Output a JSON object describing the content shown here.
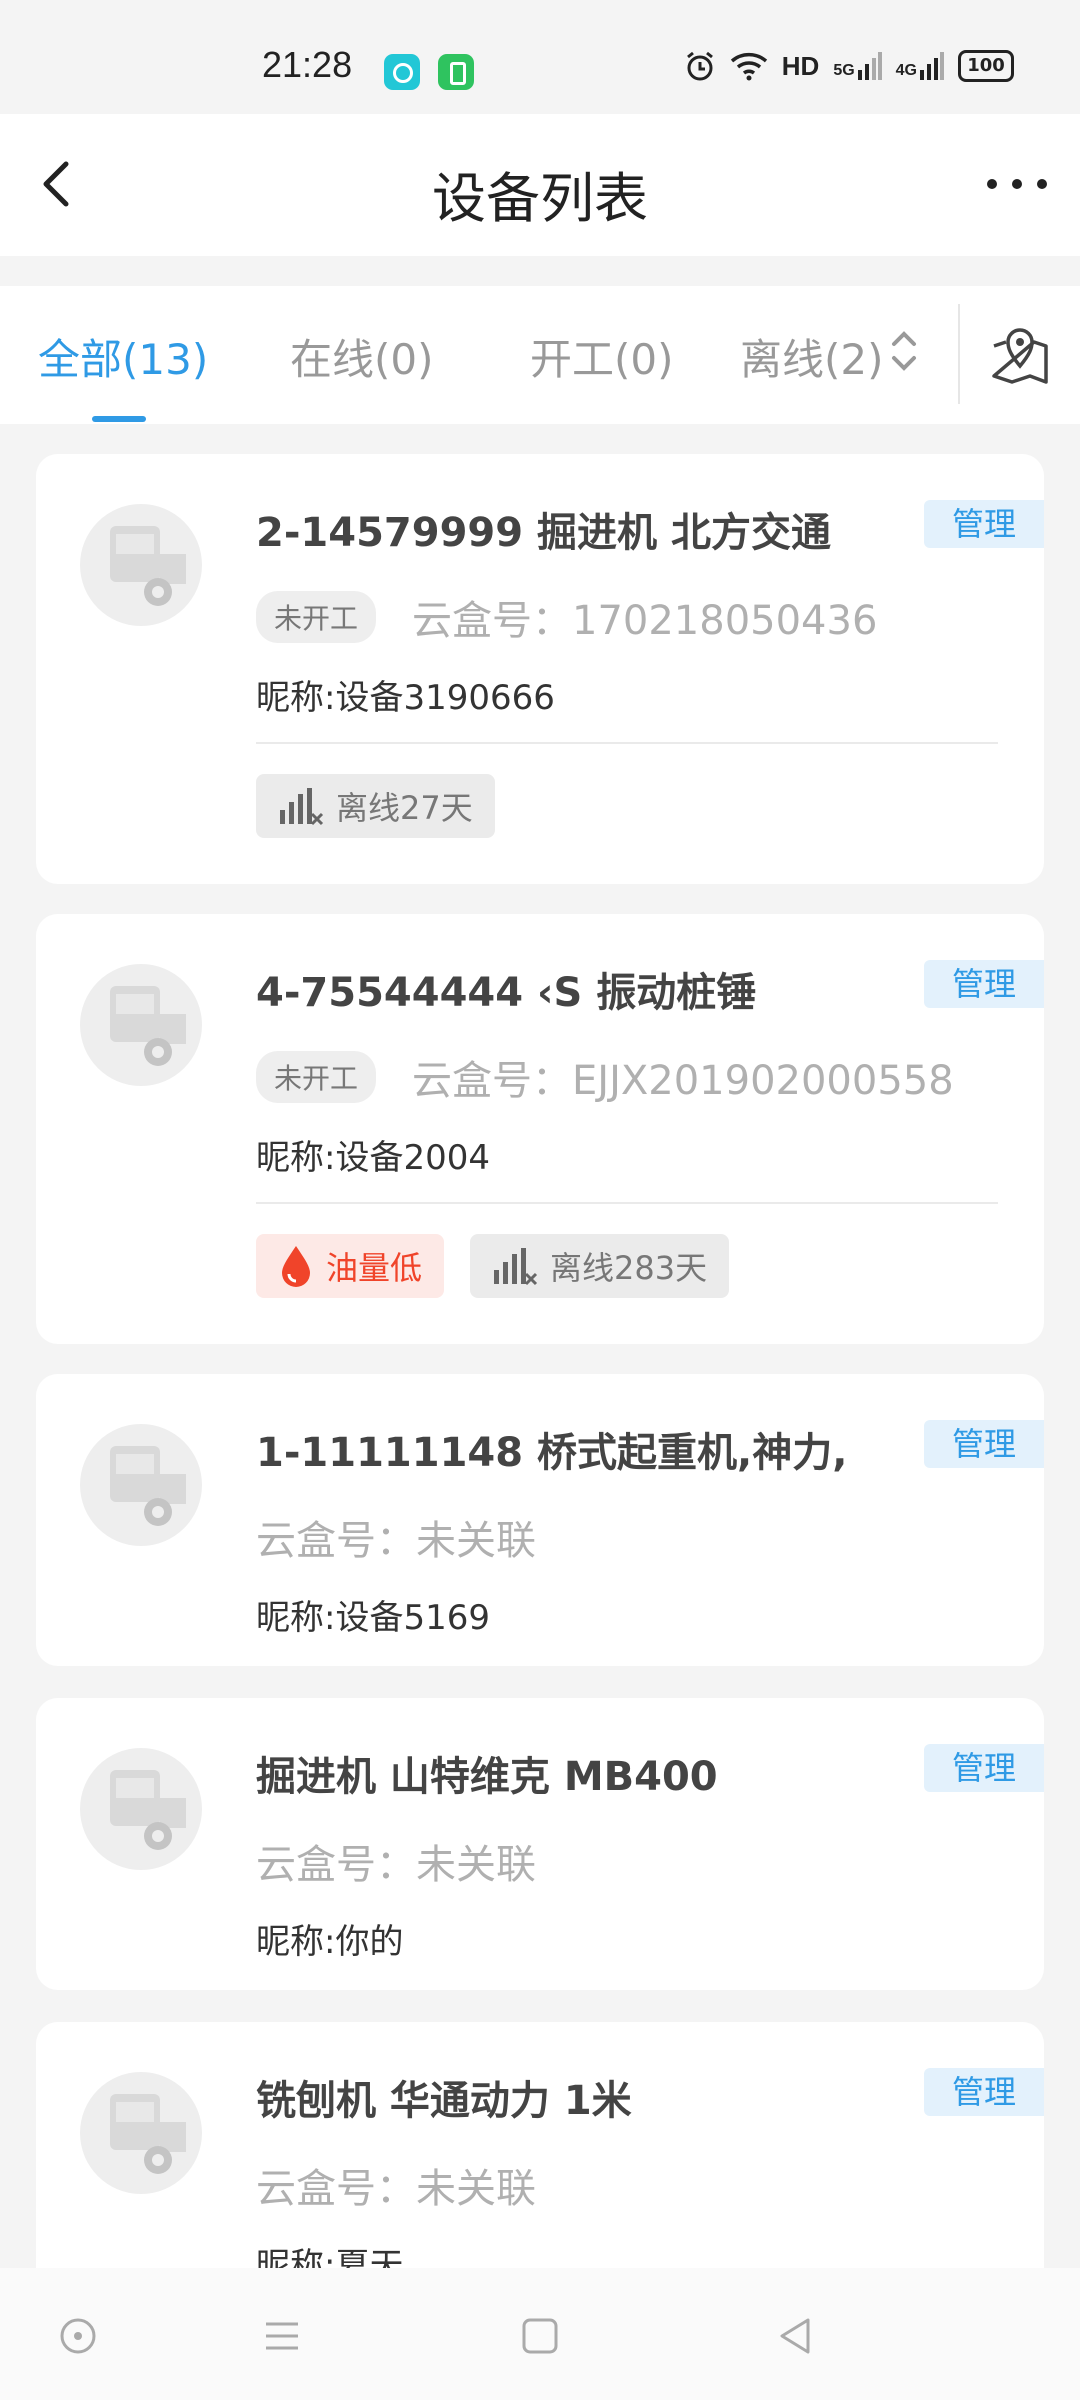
{
  "status_bar": {
    "time": "21:28",
    "network_hd": "HD",
    "network_5g": "5G",
    "network_4g": "4G",
    "battery": "100"
  },
  "header": {
    "title": "设备列表"
  },
  "tabs": [
    {
      "label": "全部(13)",
      "active": true
    },
    {
      "label": "在线(0)",
      "active": false
    },
    {
      "label": "开工(0)",
      "active": false
    },
    {
      "label": "离线(2)",
      "active": false
    }
  ],
  "manage_label": "管理",
  "devices": [
    {
      "title": "2-14579999  掘进机 北方交通",
      "status": "未开工",
      "box_no": "云盒号：170218050436",
      "nickname": "昵称:设备3190666",
      "tags": [
        {
          "type": "offline",
          "label": "离线27天"
        }
      ]
    },
    {
      "title": "4-75544444  ‹S         振动桩锤",
      "status": "未开工",
      "box_no": "云盒号：EJJX201902000558",
      "nickname": "昵称:设备2004",
      "tags": [
        {
          "type": "oil",
          "label": "油量低"
        },
        {
          "type": "offline",
          "label": "离线283天"
        }
      ]
    },
    {
      "title": "1-11111148  桥式起重机,神力,",
      "box_no": "云盒号：未关联",
      "nickname": "昵称:设备5169"
    },
    {
      "title": "掘进机 山特维克 MB400",
      "box_no": "云盒号：未关联",
      "nickname": "昵称:你的"
    },
    {
      "title": "铣刨机 华通动力 1米",
      "box_no": "云盒号：未关联",
      "nickname": "昵称:夏天"
    }
  ],
  "colors": {
    "accent": "#2f9ae5",
    "oil_low": "#f0442a"
  }
}
